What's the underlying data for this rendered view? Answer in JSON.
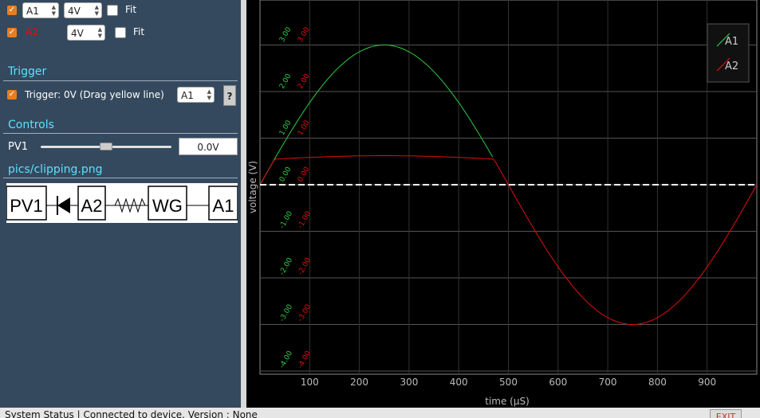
{
  "channels": [
    {
      "name": "A1",
      "range": "4V",
      "fit_label": "Fit",
      "checked": true
    },
    {
      "name": "A2",
      "range": "4V",
      "fit_label": "Fit",
      "checked": true
    }
  ],
  "trigger": {
    "title": "Trigger",
    "label": "Trigger: 0V (Drag yellow line)",
    "source": "A1",
    "help": "?"
  },
  "controls": {
    "title": "Controls",
    "pv1_label": "PV1",
    "pv1_value": "0.0V",
    "pv1_level": 0.5
  },
  "schematic": {
    "title": "pics/clipping.png",
    "labels": [
      "PV1",
      "A2",
      "WG",
      "A1"
    ]
  },
  "legend": [
    {
      "name": "A1",
      "color": "#2ecc40"
    },
    {
      "name": "A2",
      "color": "#e01010"
    }
  ],
  "status": {
    "text": "System Status | Connected to device. Version : None",
    "exit": "EXIT"
  },
  "chart_data": {
    "type": "line",
    "xlabel": "time (µS)",
    "ylabel": "voltage (V)",
    "xlim": [
      0,
      1000
    ],
    "xticks": [
      100,
      200,
      300,
      400,
      500,
      600,
      700,
      800,
      900
    ],
    "ylim": [
      -4,
      4
    ],
    "ytick_labels": {
      "A1": [
        "3.00",
        "2.00",
        "1.00",
        "0.00",
        "-1.00",
        "-2.00",
        "-3.00",
        "-4.00"
      ],
      "A2": [
        "3.00",
        "2.00",
        "1.00",
        "0.00",
        "-1.00",
        "-2.00",
        "-3.00",
        "-4.00"
      ]
    },
    "trigger_level": 0,
    "series": [
      {
        "name": "A1",
        "color": "#2ecc40",
        "amplitude": 3.0,
        "period_us": 1000,
        "x_end_us": 470
      },
      {
        "name": "A2",
        "color": "#e01010",
        "amplitude": 3.0,
        "period_us": 1000,
        "clip_high": 0.55
      }
    ]
  }
}
